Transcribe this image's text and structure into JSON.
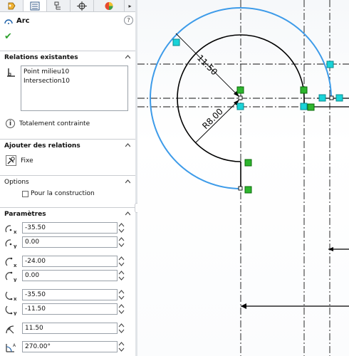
{
  "feature": {
    "title": "Arc"
  },
  "tabs": [
    {
      "name": "feature-manager"
    },
    {
      "name": "property-manager"
    },
    {
      "name": "configuration-manager"
    },
    {
      "name": "dimxpert"
    },
    {
      "name": "display-manager"
    }
  ],
  "relations": {
    "header": "Relations existantes",
    "items": [
      "Point milieu10",
      "Intersection10"
    ],
    "status": "Totalement contrainte"
  },
  "add_relations": {
    "header": "Ajouter des relations",
    "option": "Fixe"
  },
  "options": {
    "header": "Options",
    "construction_label": "Pour la construction",
    "construction_checked": false
  },
  "parameters": {
    "header": "Paramètres",
    "center_x": "-35.50",
    "center_y": "0.00",
    "start_x": "-24.00",
    "start_y": "0.00",
    "end_x": "-35.50",
    "end_y": "-11.50",
    "radius": "11.50",
    "angle": "270.00°"
  },
  "drawing": {
    "dim_radius_outer": "11.50",
    "dim_radius_inner": "R8.00",
    "colors": {
      "selected_arc": "#3d9be9",
      "sketch_line": "#000000",
      "relation_green": "#2db52d",
      "point_cyan": "#19d3d8"
    }
  }
}
